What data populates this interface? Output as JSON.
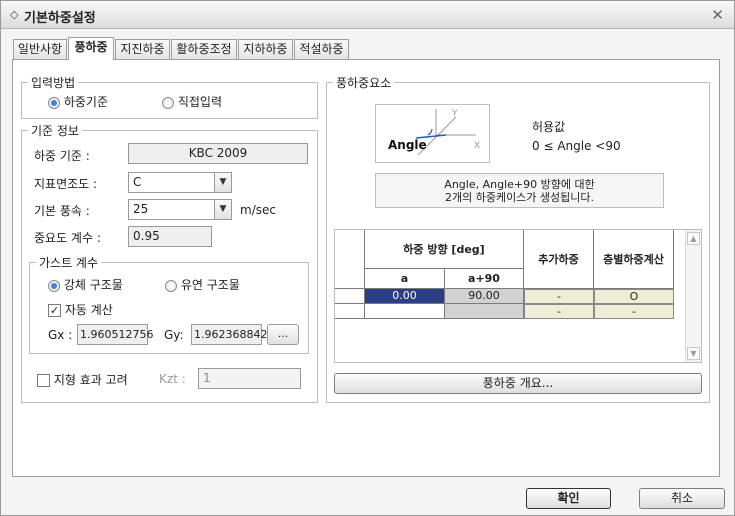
{
  "window": {
    "title": "기본하중설정",
    "title_icon": "diamond-icon",
    "close_icon": "close-icon"
  },
  "tabs": [
    {
      "label": "일반사항",
      "active": false
    },
    {
      "label": "풍하중",
      "active": true
    },
    {
      "label": "지진하중",
      "active": false
    },
    {
      "label": "활하중조정",
      "active": false
    },
    {
      "label": "지하하중",
      "active": false
    },
    {
      "label": "적설하중",
      "active": false
    }
  ],
  "input_method": {
    "title": "입력방법",
    "options": [
      {
        "label": "하중기준",
        "selected": true
      },
      {
        "label": "직접입력",
        "selected": false
      }
    ]
  },
  "standard_info": {
    "title": "기준 정보",
    "load_standard_label": "하중 기준 :",
    "load_standard_value": "KBC 2009",
    "roughness_label": "지표면조도 :",
    "roughness_value": "C",
    "wind_speed_label": "기본 풍속 :",
    "wind_speed_value": "25",
    "wind_speed_unit": "m/sec",
    "importance_label": "중요도 계수 :",
    "importance_value": "0.95"
  },
  "gust": {
    "title": "가스트 계수",
    "options": [
      {
        "label": "강체 구조물",
        "selected": true
      },
      {
        "label": "유연 구조물",
        "selected": false
      }
    ],
    "auto_calc_label": "자동 계산",
    "auto_calc_checked": true,
    "gx_label": "Gx :",
    "gx_value": "1.960512756",
    "gy_label": "Gy:",
    "gy_value": "1.962368842",
    "more_button": "..."
  },
  "topography": {
    "label": "지형 효과 고려",
    "checked": false,
    "kzt_label": "Kzt :",
    "kzt_value": "1"
  },
  "wind_elements": {
    "title": "풍하중요소",
    "diagram": {
      "angle_label": "Angle",
      "x_axis": "X",
      "y_axis": "Y"
    },
    "allow_title": "허용값",
    "allow_range": "0 ≤ Angle <90",
    "info_line1": "Angle, Angle+90 방향에 대한",
    "info_line2": "2개의 하중케이스가 생성됩니다.",
    "grid": {
      "header_direction": "하중 방향 [deg]",
      "header_a": "a",
      "header_a90": "a+90",
      "header_add": "추가하중",
      "header_floor": "층별하중계산",
      "rows": [
        {
          "a": "0.00",
          "a90": "90.00",
          "add": "-",
          "floor": "O"
        },
        {
          "a": "",
          "a90": "",
          "add": "-",
          "floor": "-"
        }
      ]
    },
    "overview_button": "풍하중 개요..."
  },
  "footer": {
    "ok_button": "확인",
    "cancel_button": "취소"
  },
  "colors": {
    "selected_cell": "#2c3e86",
    "radio_on": "#3b86d8",
    "diagram_line": "#2c55d0"
  }
}
